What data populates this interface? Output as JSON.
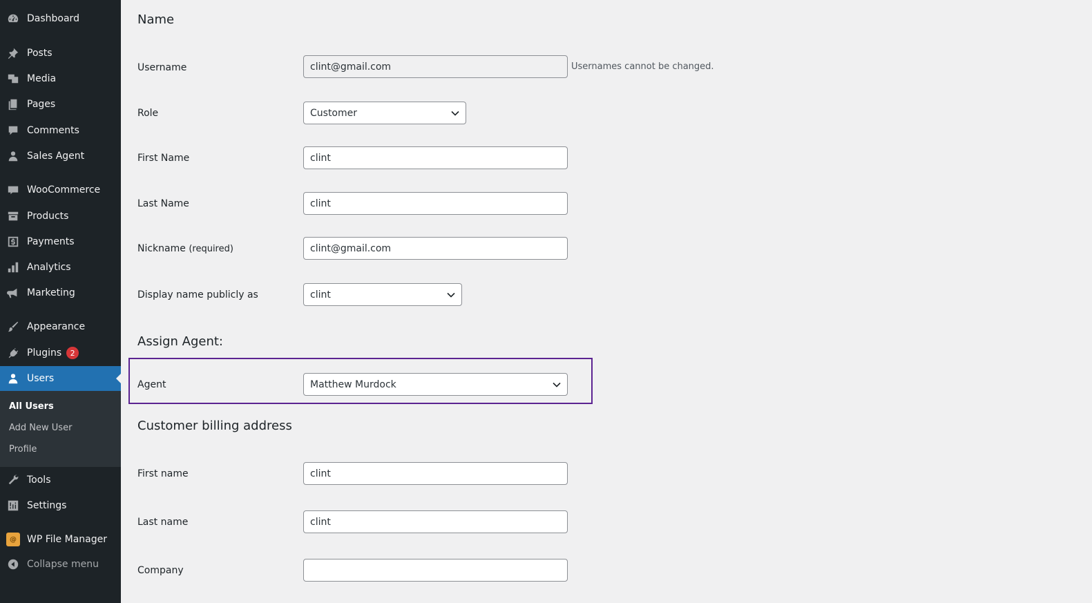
{
  "sidebar": {
    "items": [
      {
        "label": "Dashboard",
        "icon": "dashboard-icon"
      },
      {
        "label": "Posts",
        "icon": "pin-icon"
      },
      {
        "label": "Media",
        "icon": "media-icon"
      },
      {
        "label": "Pages",
        "icon": "pages-icon"
      },
      {
        "label": "Comments",
        "icon": "comment-icon"
      },
      {
        "label": "Sales Agent",
        "icon": "person-icon"
      },
      {
        "label": "WooCommerce",
        "icon": "woocommerce-icon"
      },
      {
        "label": "Products",
        "icon": "archive-icon"
      },
      {
        "label": "Payments",
        "icon": "dollar-icon"
      },
      {
        "label": "Analytics",
        "icon": "bar-chart-icon"
      },
      {
        "label": "Marketing",
        "icon": "megaphone-icon"
      },
      {
        "label": "Appearance",
        "icon": "paintbrush-icon"
      },
      {
        "label": "Plugins",
        "icon": "plug-icon",
        "badge": "2"
      },
      {
        "label": "Users",
        "icon": "users-icon"
      },
      {
        "label": "Tools",
        "icon": "wrench-icon"
      },
      {
        "label": "Settings",
        "icon": "sliders-icon"
      },
      {
        "label": "WP File Manager",
        "icon": "file-manager-icon"
      },
      {
        "label": "Collapse menu",
        "icon": "collapse-icon"
      }
    ],
    "submenu": [
      "All Users",
      "Add New User",
      "Profile"
    ],
    "colors": {
      "background": "#1d2327",
      "active": "#2271b1",
      "badge": "#d63638"
    }
  },
  "form": {
    "name_heading": "Name",
    "username": {
      "label": "Username",
      "value": "clint@gmail.com",
      "description": "Usernames cannot be changed."
    },
    "role": {
      "label": "Role",
      "value": "Customer"
    },
    "first_name": {
      "label": "First Name",
      "value": "clint"
    },
    "last_name": {
      "label": "Last Name",
      "value": "clint"
    },
    "nickname": {
      "label": "Nickname",
      "required": "(required)",
      "value": "clint@gmail.com"
    },
    "display_name": {
      "label": "Display name publicly as",
      "value": "clint"
    },
    "assign_heading": "Assign Agent:",
    "agent": {
      "label": "Agent",
      "value": "Matthew Murdock",
      "highlight_color": "#5b2391"
    },
    "billing_heading": "Customer billing address",
    "billing_first_name": {
      "label": "First name",
      "value": "clint"
    },
    "billing_last_name": {
      "label": "Last name",
      "value": "clint"
    },
    "billing_company": {
      "label": "Company",
      "value": ""
    }
  }
}
